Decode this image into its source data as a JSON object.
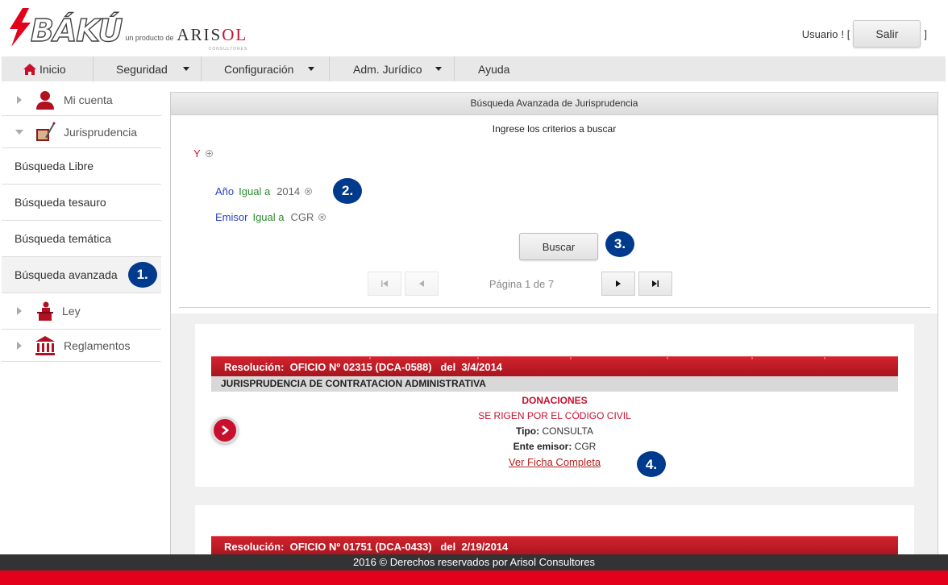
{
  "brand": {
    "logo_text": "BÁKÚ",
    "sub_text": "un producto de",
    "company": "ARIS",
    "company_accent": "OL",
    "company_sub": "CONSULTORES"
  },
  "user": {
    "label": "Usuario",
    "bracket_open": "! [",
    "bracket_close": "]",
    "logout_label": "Salir"
  },
  "nav": {
    "home": "Inicio",
    "seguridad": "Seguridad",
    "configuracion": "Configuración",
    "adm_juridico": "Adm. Jurídico",
    "ayuda": "Ayuda"
  },
  "sidebar": {
    "mi_cuenta": "Mi cuenta",
    "jurisprudencia": "Jurisprudencia",
    "busqueda_libre": "Búsqueda Libre",
    "busqueda_tesauro": "Búsqueda tesauro",
    "busqueda_tematica": "Búsqueda temática",
    "busqueda_avanzada": "Búsqueda avanzada",
    "ley": "Ley",
    "reglamentos": "Reglamentos"
  },
  "badges": {
    "b1": "1.",
    "b2": "2.",
    "b3": "3.",
    "b4": "4."
  },
  "panel": {
    "title": "Búsqueda Avanzada de Jurisprudencia",
    "hint": "Ingrese los criterios a buscar",
    "logic_op": "Y",
    "criteria": [
      {
        "field": "Año",
        "op": "Igual a",
        "value": "2014"
      },
      {
        "field": "Emisor",
        "op": "Igual a",
        "value": "CGR"
      }
    ],
    "search_label": "Buscar",
    "page_label": "Página 1 de 7"
  },
  "results": [
    {
      "header": "Resolución:  OFICIO Nº 02315 (DCA-0588)   del  3/4/2014",
      "category": "JURISPRUDENCIA DE CONTRATACION ADMINISTRATIVA",
      "tema": "DONACIONES",
      "descripcion": "SE RIGEN POR EL CÓDIGO CIVIL",
      "tipo_label": "Tipo:",
      "tipo": "CONSULTA",
      "emisor_label": "Ente emisor:",
      "emisor": "CGR",
      "link": "Ver Ficha Completa"
    },
    {
      "header": "Resolución:  OFICIO Nº 01751 (DCA-0433)   del  2/19/2014"
    }
  ],
  "footer": "2016 © Derechos reservados por Arisol Consultores",
  "colors": {
    "brand_red": "#c8102e",
    "badge_blue": "#003a8c",
    "field_blue": "#2a3fc8",
    "op_green": "#2e8b2e"
  }
}
